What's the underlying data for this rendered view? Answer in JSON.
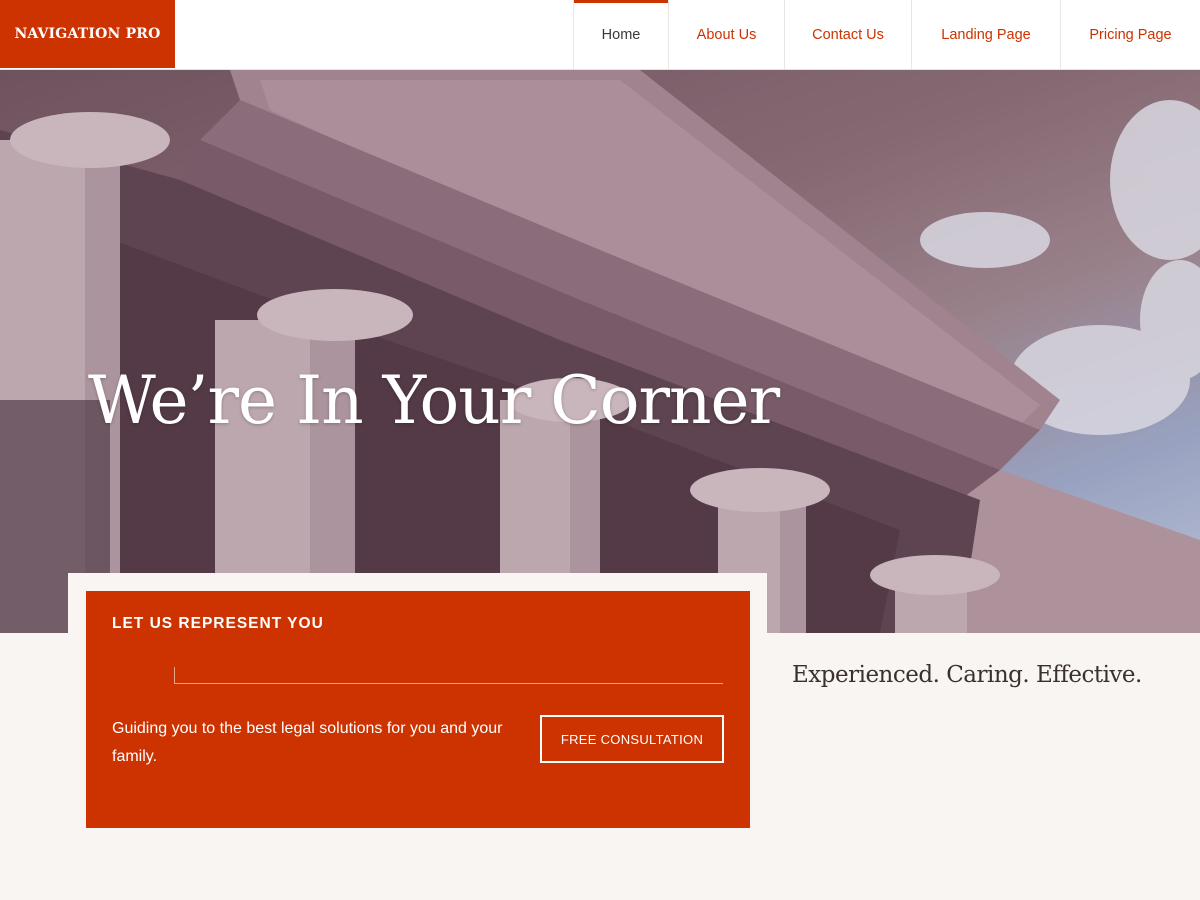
{
  "brand": {
    "logo_text": "NAVIGATION PRO",
    "accent_color": "#cc3300"
  },
  "nav": {
    "items": [
      {
        "label": "Home",
        "active": true
      },
      {
        "label": "About Us",
        "active": false
      },
      {
        "label": "Contact Us",
        "active": false
      },
      {
        "label": "Landing Page",
        "active": false
      },
      {
        "label": "Pricing Page",
        "active": false
      }
    ]
  },
  "hero": {
    "title": "We’re In Your Corner",
    "image_subject": "courthouse-columns-photo"
  },
  "card": {
    "eyebrow": "LET US REPRESENT YOU",
    "text": "Guiding you to the best legal solutions for you and your family.",
    "button_label": "FREE CONSULTATION"
  },
  "tagline": "Experienced. Caring. Effective."
}
